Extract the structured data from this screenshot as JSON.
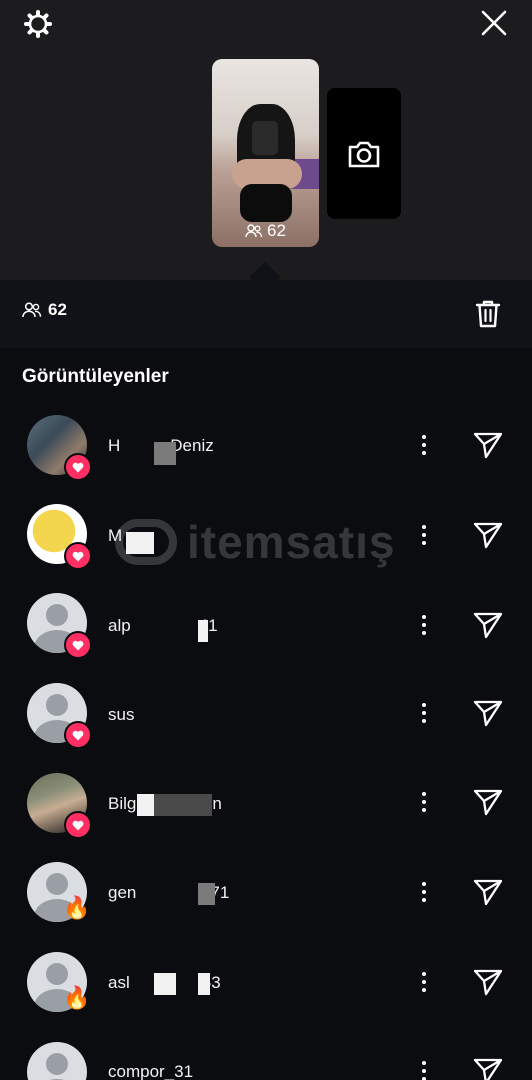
{
  "header": {
    "settings_icon": "gear-icon",
    "close_icon": "close-icon"
  },
  "story": {
    "thumb_count": "62",
    "camera_icon": "camera-icon"
  },
  "stats": {
    "viewer_count": "62",
    "delete_icon": "trash-icon"
  },
  "viewers_title": "Görüntüleyenler",
  "viewers": [
    {
      "name": "H",
      "name2": "Deniz",
      "reaction": "heart"
    },
    {
      "name": "M",
      "name2": "",
      "reaction": "heart"
    },
    {
      "name": "alp",
      "name2": "41",
      "reaction": "heart"
    },
    {
      "name": "sus",
      "name2": "",
      "reaction": "heart"
    },
    {
      "name": "Bilg",
      "name2": "n",
      "reaction": "heart"
    },
    {
      "name": "gen",
      "name2": "71",
      "reaction": "fire"
    },
    {
      "name": "asl",
      "name2": "53",
      "reaction": "fire"
    },
    {
      "name": "compor_31",
      "name2": "",
      "reaction": "none"
    }
  ],
  "watermark": "itemsatış",
  "colors": {
    "accent": "#ff2e63",
    "background": "#0b0c10",
    "top_panel": "#1c1c1e"
  }
}
